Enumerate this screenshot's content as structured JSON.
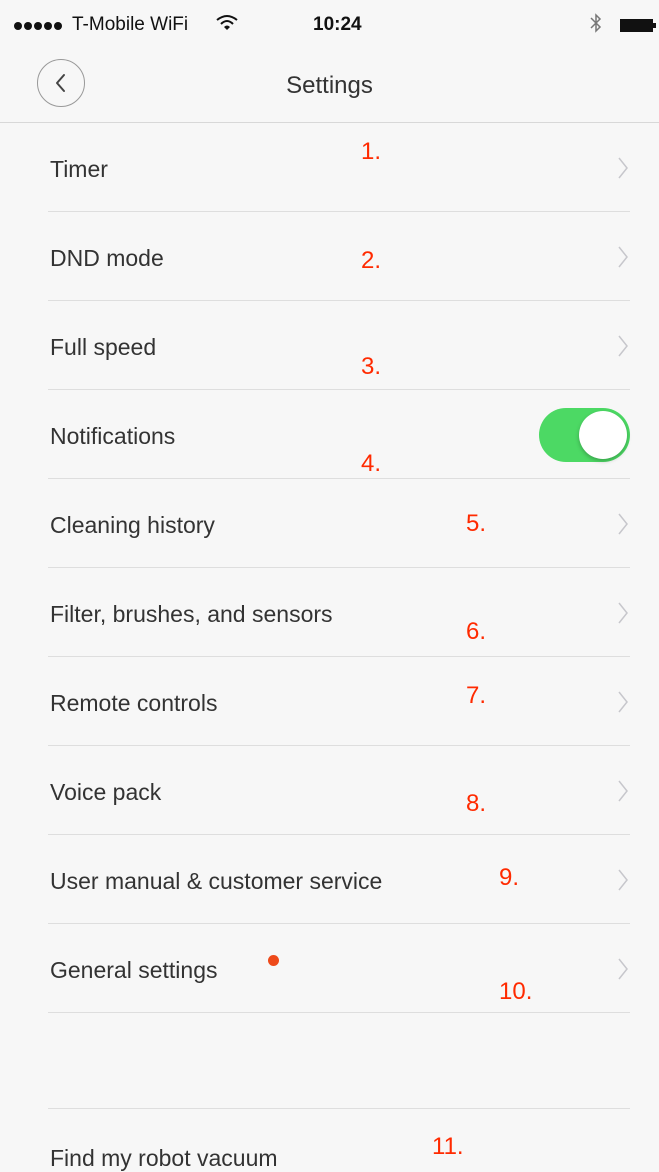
{
  "status_bar": {
    "carrier": "T-Mobile WiFi",
    "time": "10:24"
  },
  "nav": {
    "title": "Settings",
    "back_icon": "chevron-left-icon"
  },
  "rows": [
    {
      "label": "Timer",
      "annotation": "1.",
      "control": "chevron"
    },
    {
      "label": "DND mode",
      "annotation": "2.",
      "control": "chevron"
    },
    {
      "label": "Full speed",
      "annotation": "3.",
      "control": "chevron"
    },
    {
      "label": "Notifications",
      "annotation": "4.",
      "control": "toggle",
      "toggle_on": true
    },
    {
      "label": "Cleaning history",
      "annotation": "5.",
      "control": "chevron"
    },
    {
      "label": "Filter, brushes, and sensors",
      "annotation": "6.",
      "control": "chevron"
    },
    {
      "label": "Remote controls",
      "annotation": "7.",
      "control": "chevron"
    },
    {
      "label": "Voice pack",
      "annotation": "8.",
      "control": "chevron"
    },
    {
      "label": "User manual & customer service",
      "annotation": "9.",
      "control": "chevron"
    },
    {
      "label": "General settings",
      "annotation": "10.",
      "control": "chevron",
      "badge": "red-dot"
    }
  ],
  "footer": {
    "label": "Find my robot vacuum",
    "annotation": "11."
  },
  "colors": {
    "toggle_on": "#4cd964",
    "annotation": "#ff2a00",
    "badge": "#ee4a1a",
    "background": "#f7f7f7"
  }
}
